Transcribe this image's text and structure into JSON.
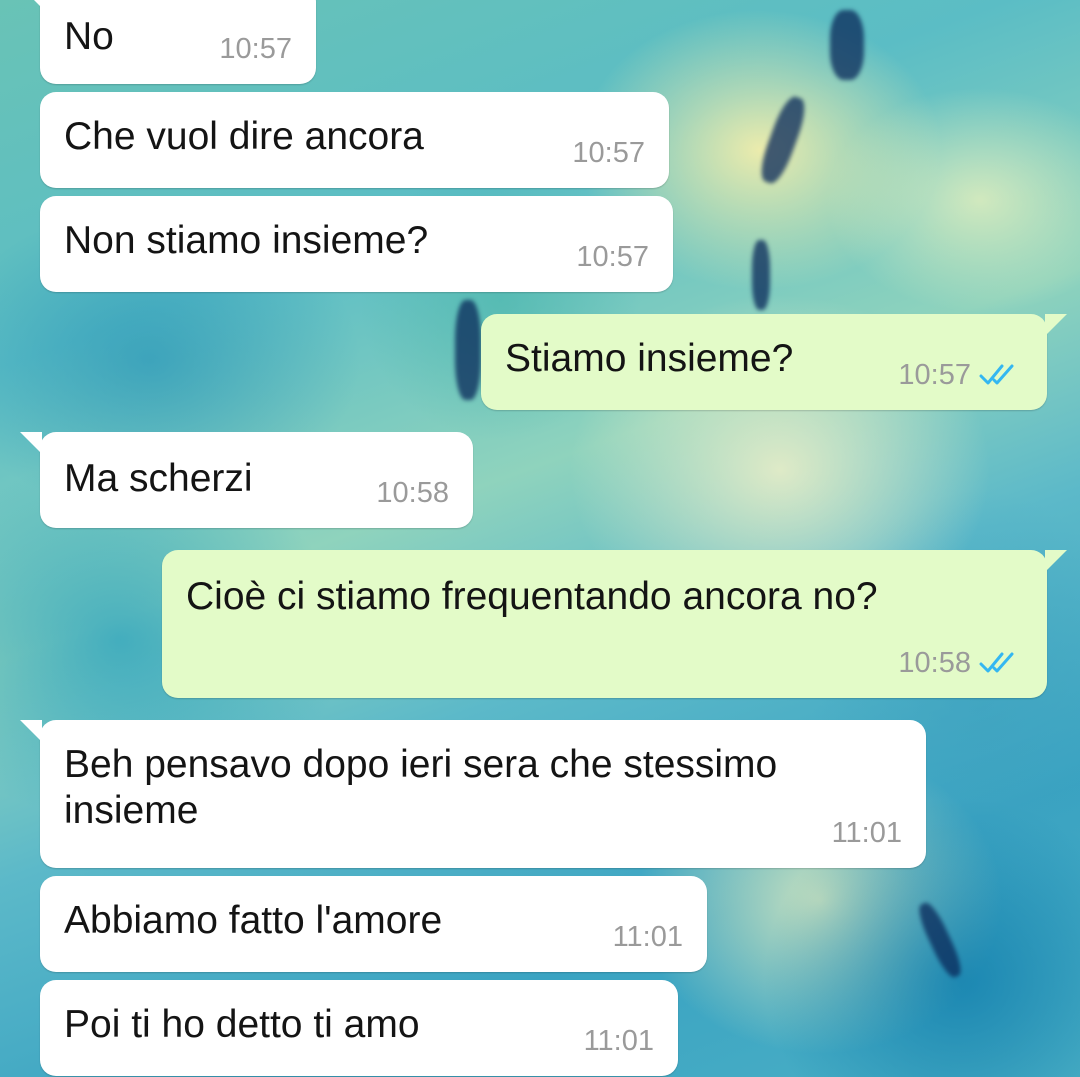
{
  "chat": {
    "messages": [
      {
        "text": "No",
        "time": "10:57",
        "direction": "incoming"
      },
      {
        "text": "Che vuol dire ancora",
        "time": "10:57",
        "direction": "incoming"
      },
      {
        "text": "Non stiamo insieme?",
        "time": "10:57",
        "direction": "incoming"
      },
      {
        "text": "Stiamo insieme?",
        "time": "10:57",
        "direction": "outgoing",
        "status": "read"
      },
      {
        "text": "Ma scherzi",
        "time": "10:58",
        "direction": "incoming"
      },
      {
        "text": "Cioè ci stiamo frequentando ancora no?",
        "time": "10:58",
        "direction": "outgoing",
        "status": "read"
      },
      {
        "text": "Beh pensavo dopo ieri sera che stessimo insieme",
        "time": "11:01",
        "direction": "incoming"
      },
      {
        "text": "Abbiamo fatto l'amore",
        "time": "11:01",
        "direction": "incoming"
      },
      {
        "text": "Poi ti ho detto ti amo",
        "time": "11:01",
        "direction": "incoming"
      }
    ]
  },
  "colors": {
    "incoming_bubble": "#ffffff",
    "outgoing_bubble": "#e3fbc8",
    "read_ticks": "#34b7f1",
    "timestamp": "#9a9a9a"
  },
  "icons": {
    "read_receipt": "double-check-icon"
  }
}
